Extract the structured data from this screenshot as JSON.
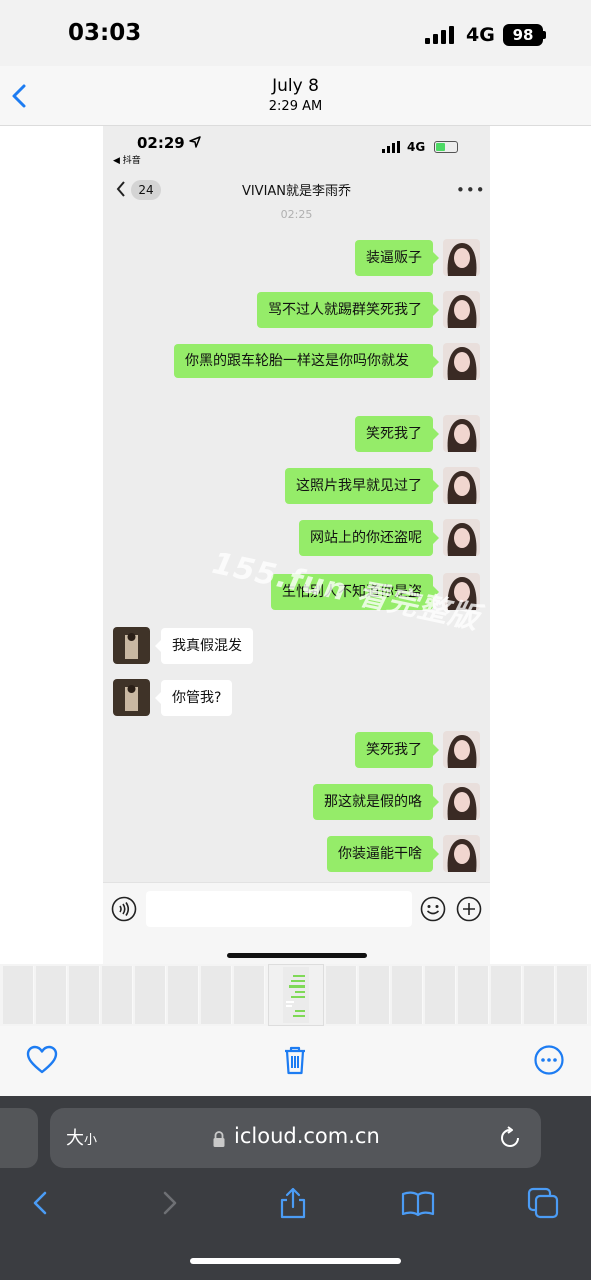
{
  "status_bar": {
    "time": "03:03",
    "network": "4G",
    "battery": "98"
  },
  "header": {
    "date": "July 8",
    "time": "2:29 AM"
  },
  "photo": {
    "status": {
      "time": "02:29",
      "app": "◀ 抖音",
      "network": "4G"
    },
    "chat": {
      "unread_count": "24",
      "title": "VIVIAN就是李雨乔",
      "more": "•••",
      "timestamp": "02:25",
      "messages": [
        {
          "side": "right",
          "text": "装逼贩子"
        },
        {
          "side": "right",
          "text": "骂不过人就踢群笑死我了"
        },
        {
          "side": "right",
          "text": "你黑的跟车轮胎一样这是你吗你就发"
        },
        {
          "side": "right",
          "text": "笑死我了"
        },
        {
          "side": "right",
          "text": "这照片我早就见过了"
        },
        {
          "side": "right",
          "text": "网站上的你还盗呢"
        },
        {
          "side": "right",
          "text": "生怕别人不知道你是盗"
        },
        {
          "side": "left",
          "text": "我真假混发"
        },
        {
          "side": "left",
          "text": "你管我?"
        },
        {
          "side": "right",
          "text": "笑死我了"
        },
        {
          "side": "right",
          "text": "那这就是假的咯"
        },
        {
          "side": "right",
          "text": "你装逼能干啥"
        }
      ]
    },
    "watermark": "155.fun 看完整版"
  },
  "toolbar": {
    "favorite_icon": "heart-icon",
    "delete_icon": "trash-icon",
    "more_icon": "ellipsis-circle-icon"
  },
  "safari": {
    "text_size_big": "大",
    "text_size_small": "小",
    "url": "icloud.com.cn"
  },
  "colors": {
    "accent": "#1d7cf2",
    "bubble_green": "#95ec69",
    "safari_bg": "#3b3d41"
  }
}
